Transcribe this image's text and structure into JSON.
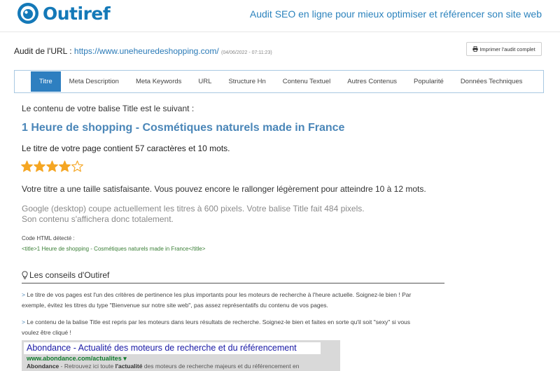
{
  "header": {
    "logo_text": "Outiref",
    "tagline": "Audit SEO en ligne pour mieux optimiser et référencer son site web"
  },
  "audit": {
    "label": "Audit de l'URL : ",
    "url": "https://www.uneheuredeshopping.com/",
    "date": "(04/06/2022 - 07:11:23)",
    "print_label": "Imprimer l'audit complet"
  },
  "tabs": [
    {
      "label": "Titre",
      "active": true
    },
    {
      "label": "Meta Description"
    },
    {
      "label": "Meta Keywords"
    },
    {
      "label": "URL"
    },
    {
      "label": "Structure Hn"
    },
    {
      "label": "Contenu Textuel"
    },
    {
      "label": "Autres Contenus"
    },
    {
      "label": "Popularité"
    },
    {
      "label": "Données Techniques"
    }
  ],
  "result": {
    "intro": "Le contenu de votre balise Title est le suivant :",
    "title": "1 Heure de shopping - Cosmétiques naturels made in France",
    "count_text": "Le titre de votre page contient 57 caractères et 10 mots.",
    "rating": {
      "value": 4,
      "max": 5
    },
    "verdict": "Votre titre a une taille satisfaisante. Vous pouvez encore le rallonger légèrement pour atteindre 10 à 12 mots.",
    "google_line1": "Google (desktop) coupe actuellement les titres à 600 pixels. Votre balise Title fait 484 pixels.",
    "google_line2": "Son contenu s'affichera donc totalement.",
    "code_label": "Code HTML détecté :",
    "code_value": "<title>1 Heure de shopping - Cosmétiques naturels made in France</title>"
  },
  "tips": {
    "heading": "Les conseils d'Outiref",
    "tip1_line1": "Le titre de vos pages est l'un des critères de pertinence les plus importants pour les moteurs de recherche à l'heure actuelle. Soignez-le bien ! Par",
    "tip1_line2": "exemple, évitez les titres du type \"Bienvenue sur notre site web\", pas assez représentatifs du contenu de vos pages.",
    "tip2_line1": "Le contenu de la balise Title est repris par les moteurs dans leurs résultats de recherche. Soignez-le bien et faites en sorte qu'il soit \"sexy\" si vous",
    "tip2_line2": "voulez être cliqué !",
    "arrow": ">"
  },
  "serp_example": {
    "title": "Abondance - Actualité des moteurs de recherche et du référencement",
    "url": "www.abondance.com/actualites",
    "desc_bold": "Abondance",
    "desc_rest": " - Retrouvez ici toute ",
    "desc_bold2": "l'actualité",
    "desc_rest2": " des moteurs de recherche majeurs et du référencement en"
  },
  "colors": {
    "brand": "#1479b8",
    "tab_active": "#2e7fc0",
    "star": "#f5a623",
    "code_green": "#3a7f36"
  }
}
